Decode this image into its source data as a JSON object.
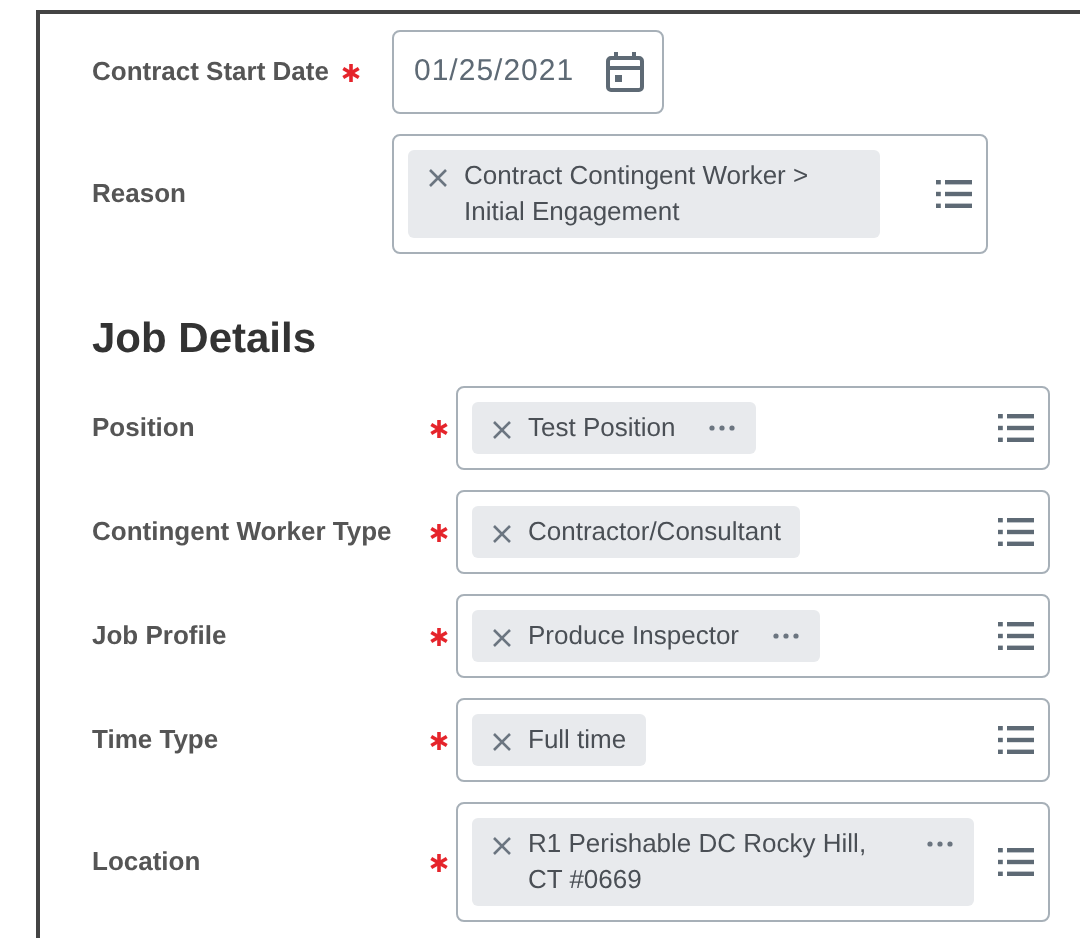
{
  "contract_fields": [
    {
      "label": "Contract Start Date",
      "required": true,
      "kind": "date",
      "value": "01/25/2021"
    },
    {
      "label": "Reason",
      "required": false,
      "kind": "prompt",
      "value": "Contract Contingent Worker > Initial Engagement",
      "has_more": false
    }
  ],
  "job_details": {
    "heading": "Job Details",
    "fields": [
      {
        "label": "Position",
        "required": true,
        "kind": "prompt",
        "value": "Test Position",
        "has_more": true
      },
      {
        "label": "Contingent Worker Type",
        "required": true,
        "kind": "prompt",
        "value": "Contractor/Consultant",
        "has_more": false
      },
      {
        "label": "Job Profile",
        "required": true,
        "kind": "prompt",
        "value": "Produce Inspector",
        "has_more": true
      },
      {
        "label": "Time Type",
        "required": true,
        "kind": "prompt",
        "value": "Full time",
        "has_more": false
      },
      {
        "label": "Location",
        "required": true,
        "kind": "prompt",
        "value": "R1 Perishable DC Rocky Hill, CT #0669",
        "has_more": true
      }
    ]
  }
}
